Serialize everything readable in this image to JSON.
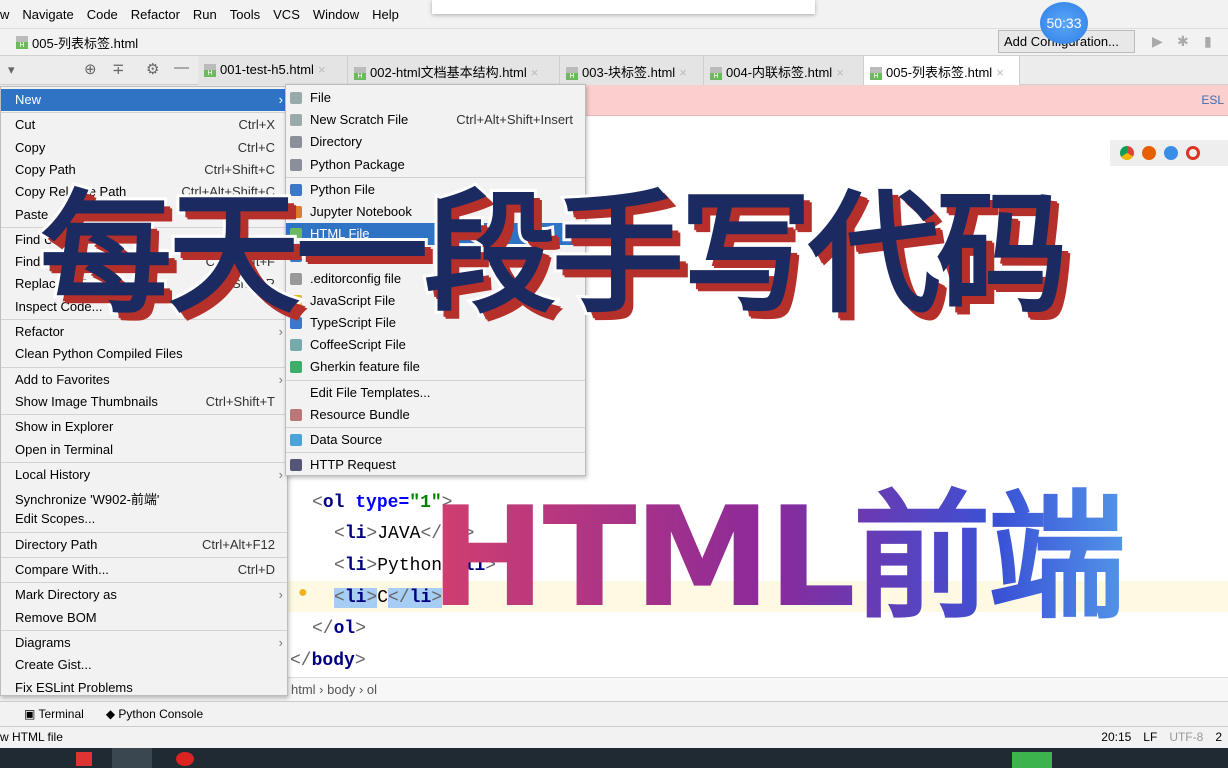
{
  "menubar": [
    "w",
    "Navigate",
    "Code",
    "Refactor",
    "Run",
    "Tools",
    "VCS",
    "Window",
    "Help"
  ],
  "nav": {
    "file": "005-列表标签.html",
    "add_config": "Add Configuration...",
    "timer": "50:33"
  },
  "tabs": [
    "001-test-h5.html",
    "002-html文档基本结构.html",
    "003-块标签.html",
    "004-内联标签.html",
    "005-列表标签.html"
  ],
  "active_tab": 4,
  "eslint_label": "ESL",
  "context_menu": [
    {
      "label": "New",
      "arrow": true,
      "selected": true
    },
    {
      "sep": true
    },
    {
      "label": "Cut",
      "shortcut": "Ctrl+X"
    },
    {
      "label": "Copy",
      "shortcut": "Ctrl+C"
    },
    {
      "label": "Copy Path",
      "shortcut": "Ctrl+Shift+C"
    },
    {
      "label": "Copy Relative Path",
      "shortcut": "Ctrl+Alt+Shift+C"
    },
    {
      "label": "Paste",
      "shortcut": "Ctrl+V"
    },
    {
      "sep": true
    },
    {
      "label": "Find Usages",
      "shortcut": "Alt+F7"
    },
    {
      "label": "Find in Path...",
      "shortcut": "Ctrl+Shift+F"
    },
    {
      "label": "Replace in Path...",
      "shortcut": "Ctrl+Shift+R"
    },
    {
      "label": "Inspect Code..."
    },
    {
      "sep": true
    },
    {
      "label": "Refactor",
      "arrow": true
    },
    {
      "label": "Clean Python Compiled Files"
    },
    {
      "sep": true
    },
    {
      "label": "Add to Favorites",
      "arrow": true
    },
    {
      "label": "Show Image Thumbnails",
      "shortcut": "Ctrl+Shift+T"
    },
    {
      "sep": true
    },
    {
      "label": "Show in Explorer"
    },
    {
      "label": "Open in Terminal"
    },
    {
      "sep": true
    },
    {
      "label": "Local History",
      "arrow": true
    },
    {
      "label": "Synchronize 'W902-前端'"
    },
    {
      "label": "Edit Scopes..."
    },
    {
      "sep": true
    },
    {
      "label": "Directory Path",
      "shortcut": "Ctrl+Alt+F12"
    },
    {
      "sep": true
    },
    {
      "label": "Compare With...",
      "shortcut": "Ctrl+D"
    },
    {
      "sep": true
    },
    {
      "label": "Mark Directory as",
      "arrow": true
    },
    {
      "label": "Remove BOM"
    },
    {
      "sep": true
    },
    {
      "label": "Diagrams",
      "arrow": true
    },
    {
      "label": "Create Gist..."
    },
    {
      "label": "Fix ESLint Problems"
    }
  ],
  "new_submenu": [
    {
      "label": "File",
      "icon": "#9aa"
    },
    {
      "label": "New Scratch File",
      "shortcut": "Ctrl+Alt+Shift+Insert",
      "icon": "#9aa"
    },
    {
      "label": "Directory",
      "icon": "#8a8f99"
    },
    {
      "label": "Python Package",
      "icon": "#8a8f99"
    },
    {
      "sep": true
    },
    {
      "label": "Python File",
      "icon": "#3c78c8"
    },
    {
      "label": "Jupyter Notebook",
      "icon": "#e07b2a"
    },
    {
      "label": "HTML File",
      "icon": "#6cb95e",
      "selected": true
    },
    {
      "label": "Stylesheet",
      "icon": "#3c78c8"
    },
    {
      "label": ".editorconfig file",
      "icon": "#999"
    },
    {
      "label": "JavaScript File",
      "icon": "#e0b52a"
    },
    {
      "label": "TypeScript File",
      "icon": "#3c78c8"
    },
    {
      "label": "CoffeeScript File",
      "icon": "#7aa"
    },
    {
      "label": "Gherkin feature file",
      "icon": "#3cae6a"
    },
    {
      "sep": true
    },
    {
      "label": "Edit File Templates..."
    },
    {
      "label": "Resource Bundle",
      "icon": "#b77"
    },
    {
      "sep": true
    },
    {
      "label": "Data Source",
      "icon": "#4aa3d8"
    },
    {
      "sep": true
    },
    {
      "label": "HTTP Request",
      "icon": "#557"
    }
  ],
  "code": {
    "ol_open_tag": "ol",
    "ol_attr": "type",
    "ol_value": "\"1\"",
    "li_tag": "li",
    "items": [
      "JAVA",
      "Python",
      "C"
    ],
    "body_tag": "body"
  },
  "breadcrumb": [
    "html",
    "body",
    "ol"
  ],
  "toolwindows": [
    "Terminal",
    "Python Console"
  ],
  "status": {
    "message": "w HTML file",
    "position": "20:15",
    "line_sep": "LF",
    "encoding": "UTF-8",
    "indent": "2"
  },
  "overlay": {
    "banner": "每天一段手写代码",
    "subtitle": "HTML前端"
  }
}
